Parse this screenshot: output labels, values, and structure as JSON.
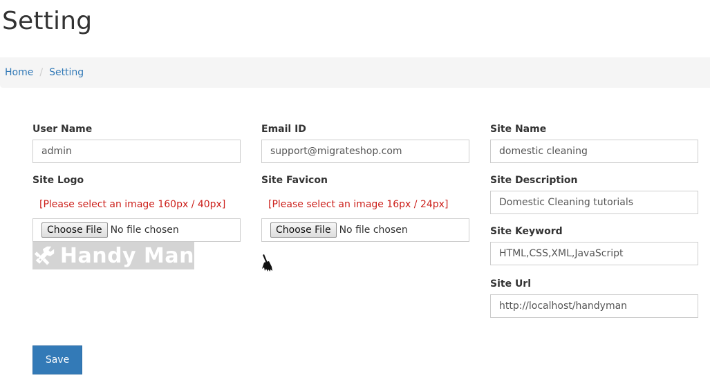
{
  "page": {
    "title": "Setting"
  },
  "breadcrumb": {
    "home": "Home",
    "separator": "/",
    "current": "Setting"
  },
  "form": {
    "user_name": {
      "label": "User Name",
      "value": "admin"
    },
    "email_id": {
      "label": "Email ID",
      "value": "support@migrateshop.com"
    },
    "site_name": {
      "label": "Site Name",
      "value": "domestic cleaning"
    },
    "site_logo": {
      "label": "Site Logo",
      "hint": "[Please select an image 160px / 40px]",
      "button": "Choose File",
      "status": "No file chosen",
      "preview_text": "Handy Man"
    },
    "site_favicon": {
      "label": "Site Favicon",
      "hint": "[Please select an image 16px / 24px]",
      "button": "Choose File",
      "status": "No file chosen"
    },
    "site_description": {
      "label": "Site Description",
      "value": "Domestic Cleaning tutorials"
    },
    "site_keyword": {
      "label": "Site Keyword",
      "value": "HTML,CSS,XML,JavaScript"
    },
    "site_url": {
      "label": "Site Url",
      "value": "http://localhost/handyman"
    },
    "save": "Save"
  },
  "colors": {
    "link": "#337ab7",
    "hint": "#cc1f1a",
    "primary_button": "#337ab7",
    "breadcrumb_bg": "#f5f5f5"
  },
  "icons": {
    "logo_preview": "wrench-icon",
    "favicon_preview": "broom-icon"
  }
}
